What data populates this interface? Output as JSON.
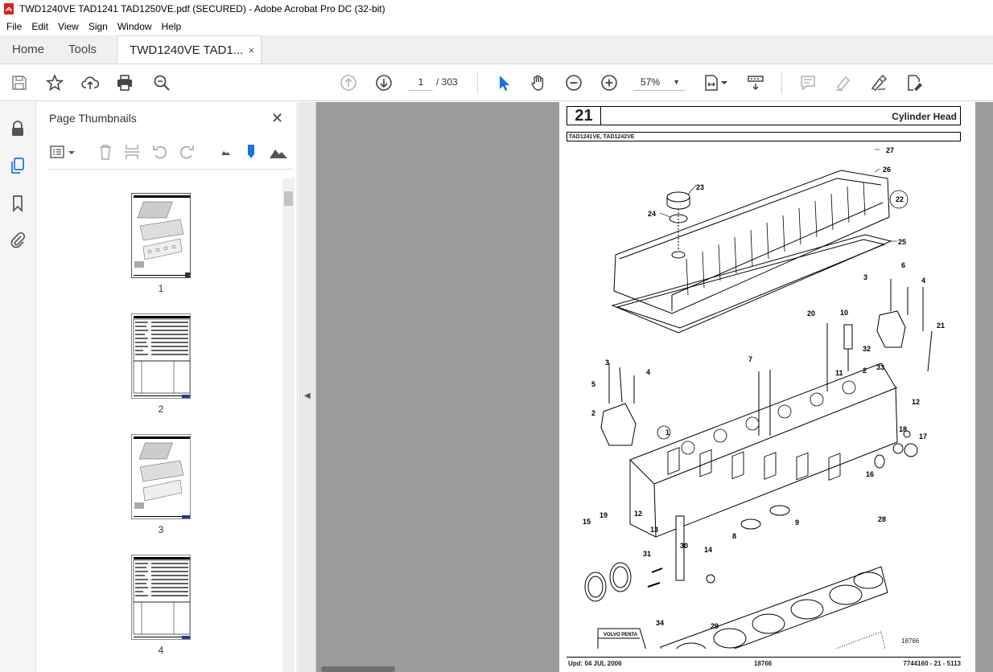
{
  "window": {
    "title": "TWD1240VE  TAD1241 TAD1250VE.pdf (SECURED) - Adobe Acrobat Pro DC (32-bit)"
  },
  "menu": [
    "File",
    "Edit",
    "View",
    "Sign",
    "Window",
    "Help"
  ],
  "tabs": {
    "home": "Home",
    "tools": "Tools",
    "document": "TWD1240VE  TAD1...",
    "close_glyph": "×"
  },
  "toolbar": {
    "current_page": "1",
    "total_pages": "/ 303",
    "zoom": "57%"
  },
  "thumbnails_panel": {
    "title": "Page Thumbnails",
    "items": [
      {
        "label": "1"
      },
      {
        "label": "2"
      },
      {
        "label": "3"
      },
      {
        "label": "4"
      }
    ]
  },
  "document_page": {
    "section_number": "21",
    "section_title": "Cylinder Head",
    "models": "TAD1241VE, TAD1242VE",
    "figure_number": "18766",
    "footer_left": "Upd: 04 JUL 2006",
    "footer_mid": "18766",
    "footer_right": "7744160 - 21 - 5113",
    "callouts": [
      "1",
      "2",
      "3",
      "4",
      "5",
      "6",
      "7",
      "8",
      "9",
      "10",
      "11",
      "12",
      "13",
      "14",
      "15",
      "16",
      "17",
      "18",
      "19",
      "20",
      "21",
      "22",
      "23",
      "24",
      "25",
      "26",
      "27",
      "28",
      "29",
      "30",
      "31",
      "32",
      "33",
      "34"
    ],
    "logo_text": "VOLVO PENTA"
  },
  "colors": {
    "accent_blue": "#1473e6",
    "canvas_gray": "#9b9b9b",
    "pdf_red": "#d7231f"
  }
}
